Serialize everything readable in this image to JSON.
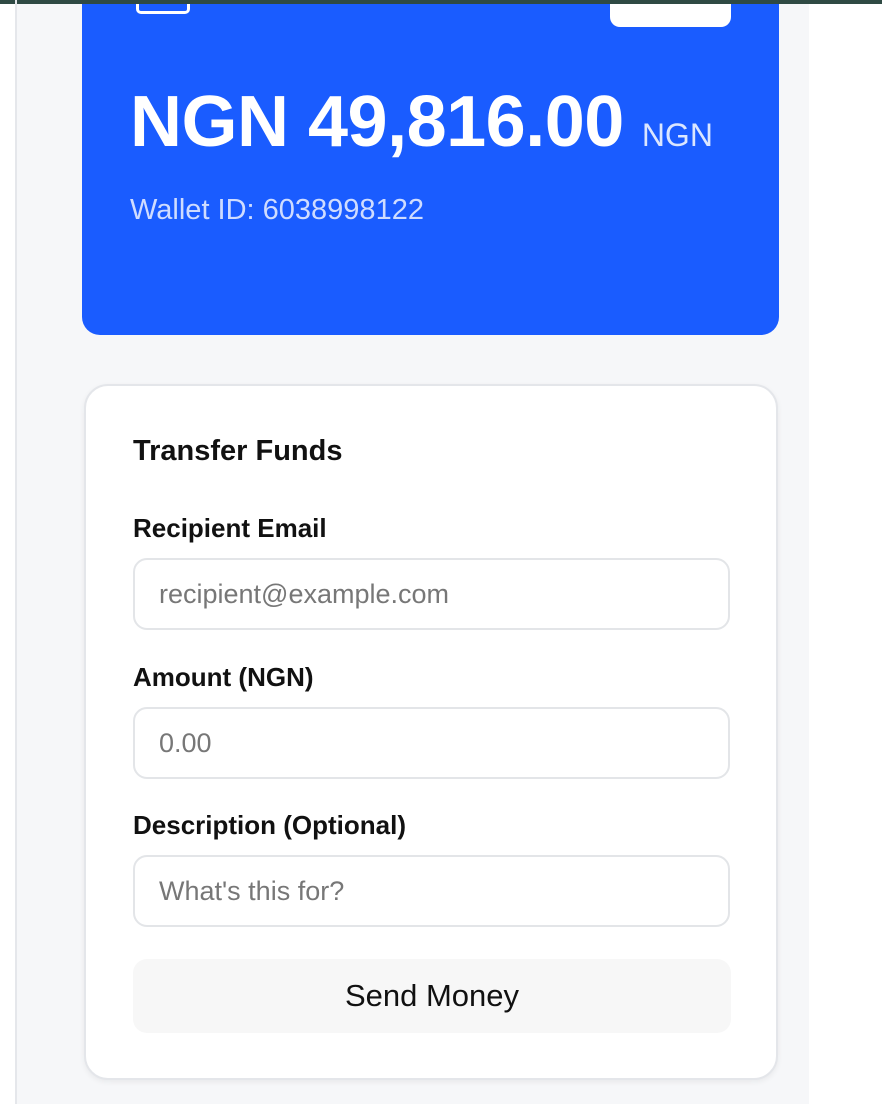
{
  "wallet": {
    "balance": "NGN 49,816.00",
    "currency": "NGN",
    "wallet_id_label": "Wallet ID: 6038998122"
  },
  "transfer_form": {
    "title": "Transfer Funds",
    "recipient_label": "Recipient Email",
    "recipient_placeholder": "recipient@example.com",
    "amount_label": "Amount (NGN)",
    "amount_placeholder": "0.00",
    "description_label": "Description (Optional)",
    "description_placeholder": "What's this for?",
    "submit_label": "Send Money"
  },
  "colors": {
    "wallet_card": "#1a5cff",
    "page_background": "#f6f7f9",
    "top_bar": "#2f4a44"
  }
}
